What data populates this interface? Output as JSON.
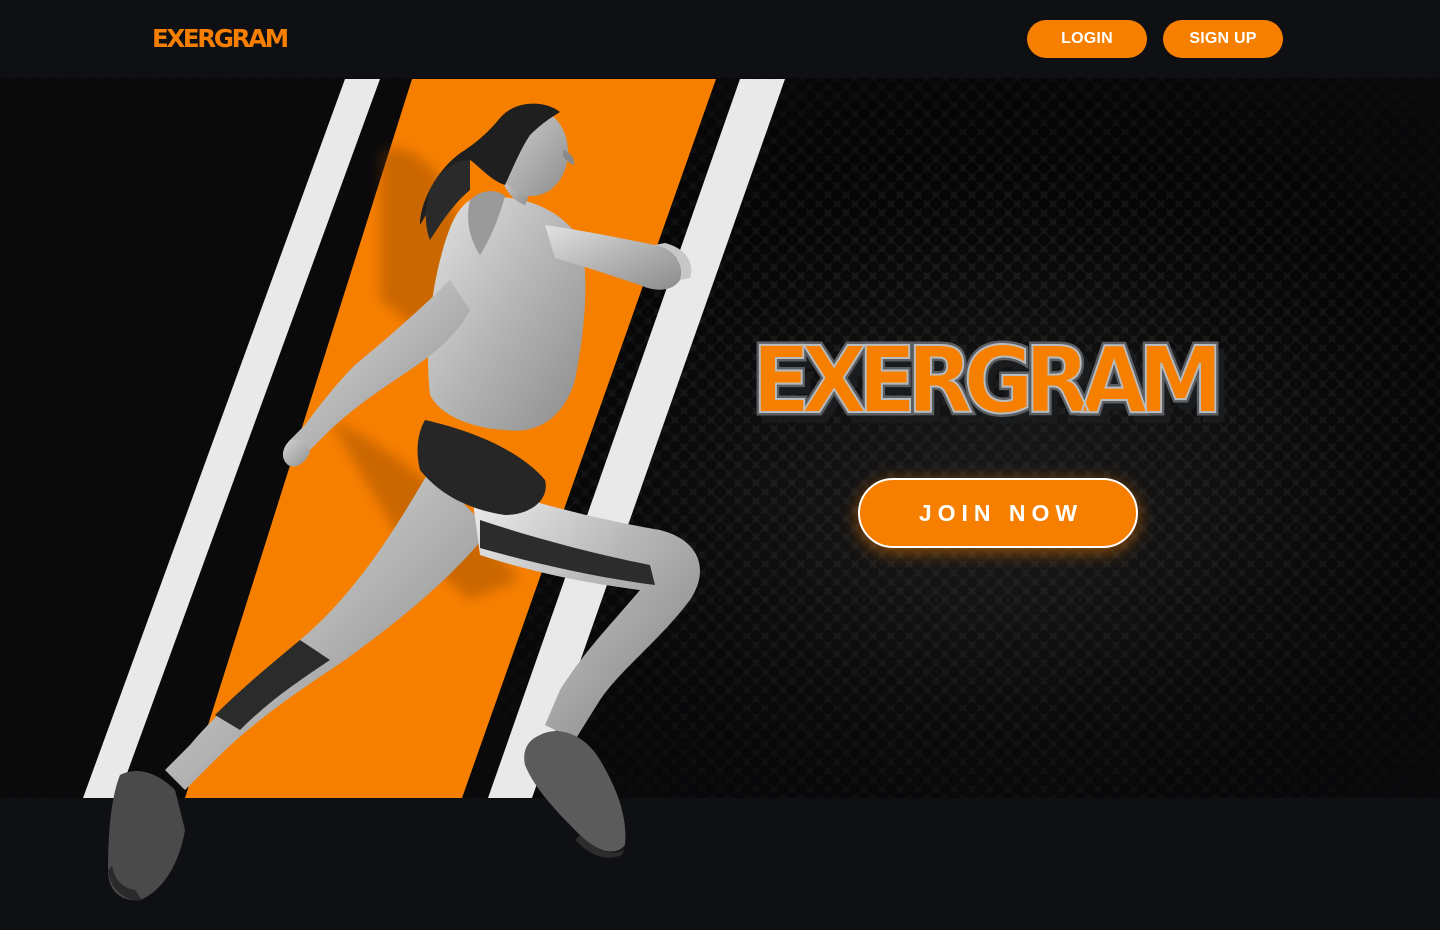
{
  "header": {
    "logo_text": "EXERGRAM",
    "login_label": "LOGIN",
    "signup_label": "SIGN UP"
  },
  "hero": {
    "title": "EXERGRAM",
    "join_label": "JOIN NOW",
    "image": "athlete-running-photo"
  },
  "colors": {
    "accent": "#f77f00",
    "background": "#101114",
    "header_bg": "#0f1014",
    "stripe_light": "#e9e9e9",
    "text_on_accent": "#ffffff"
  }
}
